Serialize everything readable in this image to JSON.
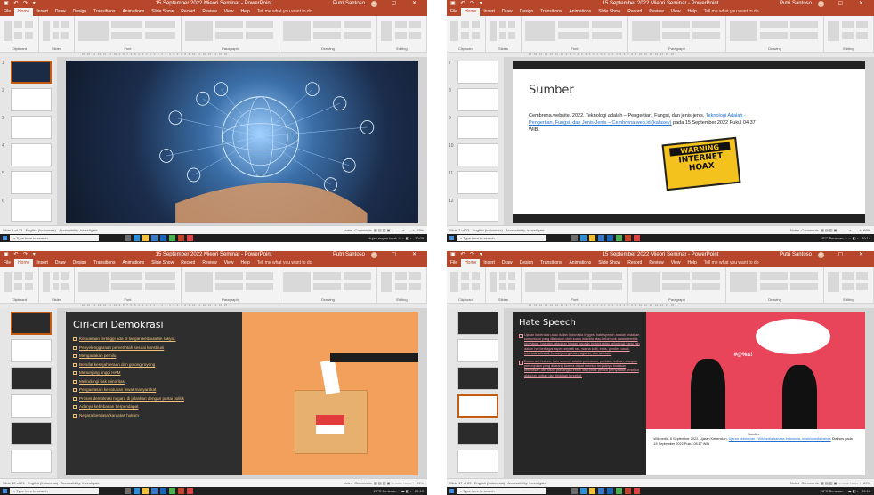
{
  "windows": [
    {
      "title": "15 September 2022 Mieori Seminar - PowerPoint",
      "account": "Putri Santoso",
      "slide_count": "Slide 1 of 23",
      "taskbar_search": "Type here to search",
      "tray_text": "Hujan ringan lokal",
      "time": "20:09"
    },
    {
      "title": "15 September 2022 Mieori Seminar - PowerPoint",
      "account": "Putri Santoso",
      "slide_count": "Slide 7 of 23",
      "taskbar_search": "Type here to search",
      "tray_text": "28°C Berawan",
      "time": "20:14"
    },
    {
      "title": "15 September 2022 Mieori Seminar - PowerPoint",
      "account": "Putri Santoso",
      "slide_count": "Slide 12 of 23",
      "taskbar_search": "Type here to search",
      "tray_text": "28°C Berawan",
      "time": "20:10"
    },
    {
      "title": "15 September 2022 Mieori Seminar - PowerPoint",
      "account": "Putri Santoso",
      "slide_count": "Slide 17 of 23",
      "taskbar_search": "Type here to search",
      "tray_text": "28°C Berawan",
      "time": "20:13"
    }
  ],
  "tabs": [
    "File",
    "Home",
    "Insert",
    "Draw",
    "Design",
    "Transitions",
    "Animations",
    "Slide Show",
    "Record",
    "Review",
    "View",
    "Help"
  ],
  "tell_me": "Tell me what you want to do",
  "ribbon_groups": [
    "Clipboard",
    "Slides",
    "Font",
    "Paragraph",
    "Drawing",
    "Editing"
  ],
  "status": {
    "language": "English (Indonesia)",
    "accessibility": "Accessibility: Investigate",
    "notes": "Notes",
    "comments": "Comments",
    "zoom": "69%"
  },
  "slide_sumber": {
    "title": "Sumber",
    "body_plain": "Cembrena.website. 2022. Teknologi adalah – Pengertian, Fungsi, dan jenis-jenis.",
    "body_link": "Teknologi Adalah - Pengertian, Fungsi, dan Jenis-Jenis – Cembrena.web.id (kalasey)",
    "body_tail": "pada 15 September 2022 Pukul 04:37 WIB.",
    "sign_warning": "WARNING",
    "sign_l1": "INTERNET",
    "sign_l2": "HOAX"
  },
  "slide_demokrasi": {
    "title": "Ciri-ciri Demokrasi",
    "items": [
      "Kekuasaan tertinggi ada di tangan kedaulatan rakyat.",
      "Penyelenggaraan pemerintah sesuai konstitusi",
      "Mengadakan pemilu",
      "Bersifat kesejahteraan dan gotong royong",
      "Menunjang tinggi HAM",
      "Melindungi hak minoritas",
      "Pengawasan kepatuhan lewat masyarakat",
      "Proses demokrasi negara di jalankan dengan partai politik",
      "Adanya kebebasan berpendapat",
      "Negara berdasarkan atas hukum"
    ]
  },
  "slide_hate": {
    "title": "Hate Speech",
    "p1": "Ujaran kebencian atau istilah Indonesia Inggris: hate speech adalah tindakan komunikasi yang dilakukan oleh suatu individu atau kelompok dalam bentuk provokasi, hasutan, ataupun hinaan kepada individu atau kelompok yang lain dalam hal berbagai aspek seperti ras, warna kulit, etnis, gender, cacat, orientasi seksual, kewarganegaraan, agama, dan lain-lain.",
    "p2": "Dalam arti hukum, hate speech adalah perkataan, perilaku, tulisan, ataupun pertunjukan yang dilarang karena dapat memicu terjadinya tindakan kekerasan dan sikap prasangka entah dari pihak pelaku pernyataan tersebut ataupun korban dari tindakan tersebut.",
    "source_title": "Sumber:",
    "source_text": "Wikipedia, 6 September 2022. Ujaran Kebencian.",
    "source_link": "Ujaran kebencian - Wikipedia bahasa Indonesia, ensiklopedia bebas",
    "source_tail": "Diakses pada 15 September 2022 Pukul 08:17 WIB",
    "bubble_text": "#@%&!"
  },
  "colors": {
    "accent": "#b7472a",
    "ribbon": "#f3f3f3",
    "panel": "#e6e6e6",
    "demokrasi_bg": "#2e2e2e",
    "demokrasi_right": "#f2a05c",
    "hate_bg": "#262626",
    "hate_right": "#e8455b",
    "link": "#1f6fd1"
  },
  "icons": [
    "win-logo-icon",
    "search-icon",
    "save-icon",
    "undo-icon",
    "redo-icon",
    "close-icon",
    "minimize-icon",
    "maximize-icon"
  ]
}
